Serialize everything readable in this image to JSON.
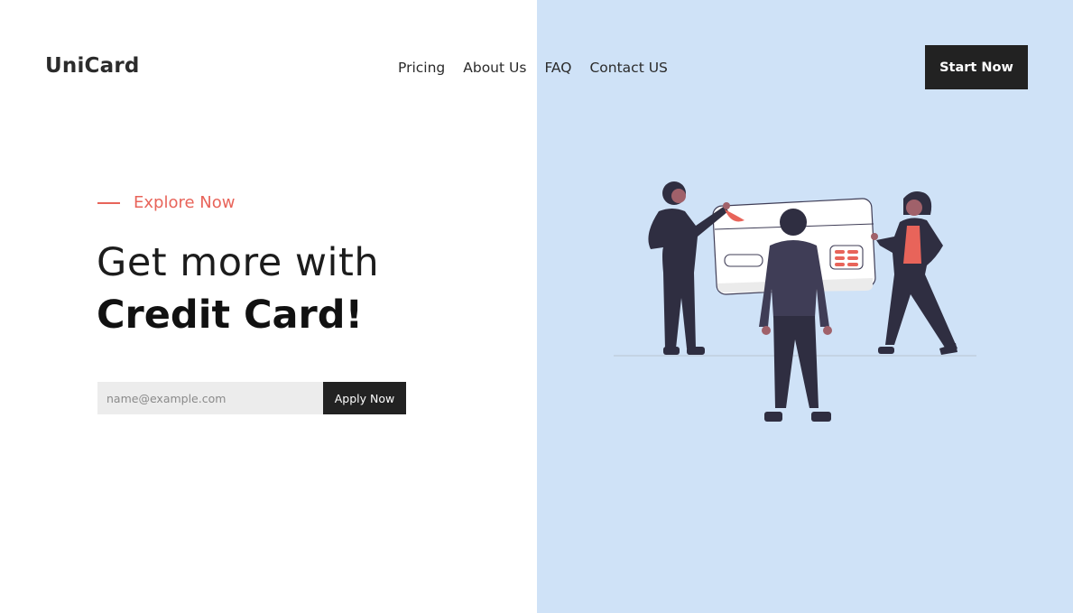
{
  "header": {
    "logo": "UniCard",
    "nav": [
      {
        "label": "Pricing"
      },
      {
        "label": "About Us"
      },
      {
        "label": "FAQ"
      },
      {
        "label": "Contact US"
      }
    ],
    "cta_label": "Start Now"
  },
  "hero": {
    "eyebrow": "Explore Now",
    "headline_line1": "Get more with",
    "headline_line2": "Credit Card!",
    "email_placeholder": "name@example.com",
    "apply_label": "Apply Now"
  },
  "colors": {
    "accent": "#e8645a",
    "dark": "#222222",
    "panel": "#cfe2f7"
  },
  "icons": {
    "illustration": "people-with-credit-card-illustration"
  }
}
